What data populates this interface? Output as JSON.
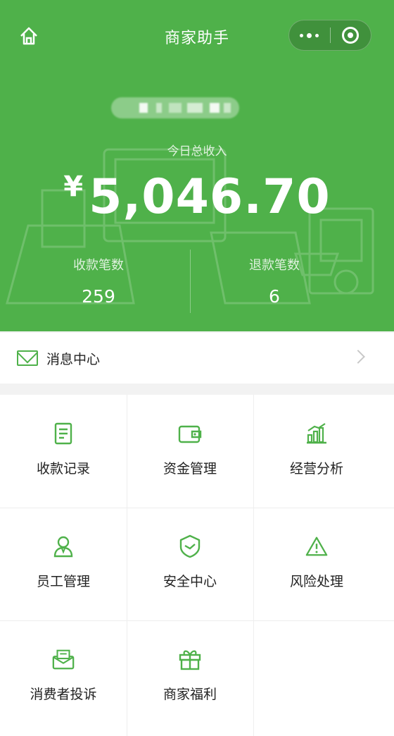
{
  "header": {
    "title": "商家助手",
    "accent_color": "#4fb14a"
  },
  "summary": {
    "income_label": "今日总收入",
    "currency": "¥",
    "income_amount": "5,046.70",
    "payments_label": "收款笔数",
    "payments_count": "259",
    "refunds_label": "退款笔数",
    "refunds_count": "6"
  },
  "messages": {
    "label": "消息中心"
  },
  "grid": {
    "items": [
      {
        "label": "收款记录",
        "icon": "receipt-icon"
      },
      {
        "label": "资金管理",
        "icon": "wallet-icon"
      },
      {
        "label": "经营分析",
        "icon": "bar-chart-icon"
      },
      {
        "label": "员工管理",
        "icon": "staff-icon"
      },
      {
        "label": "安全中心",
        "icon": "shield-icon"
      },
      {
        "label": "风险处理",
        "icon": "warning-icon"
      },
      {
        "label": "消费者投诉",
        "icon": "complaint-icon"
      },
      {
        "label": "商家福利",
        "icon": "gift-icon"
      }
    ]
  }
}
